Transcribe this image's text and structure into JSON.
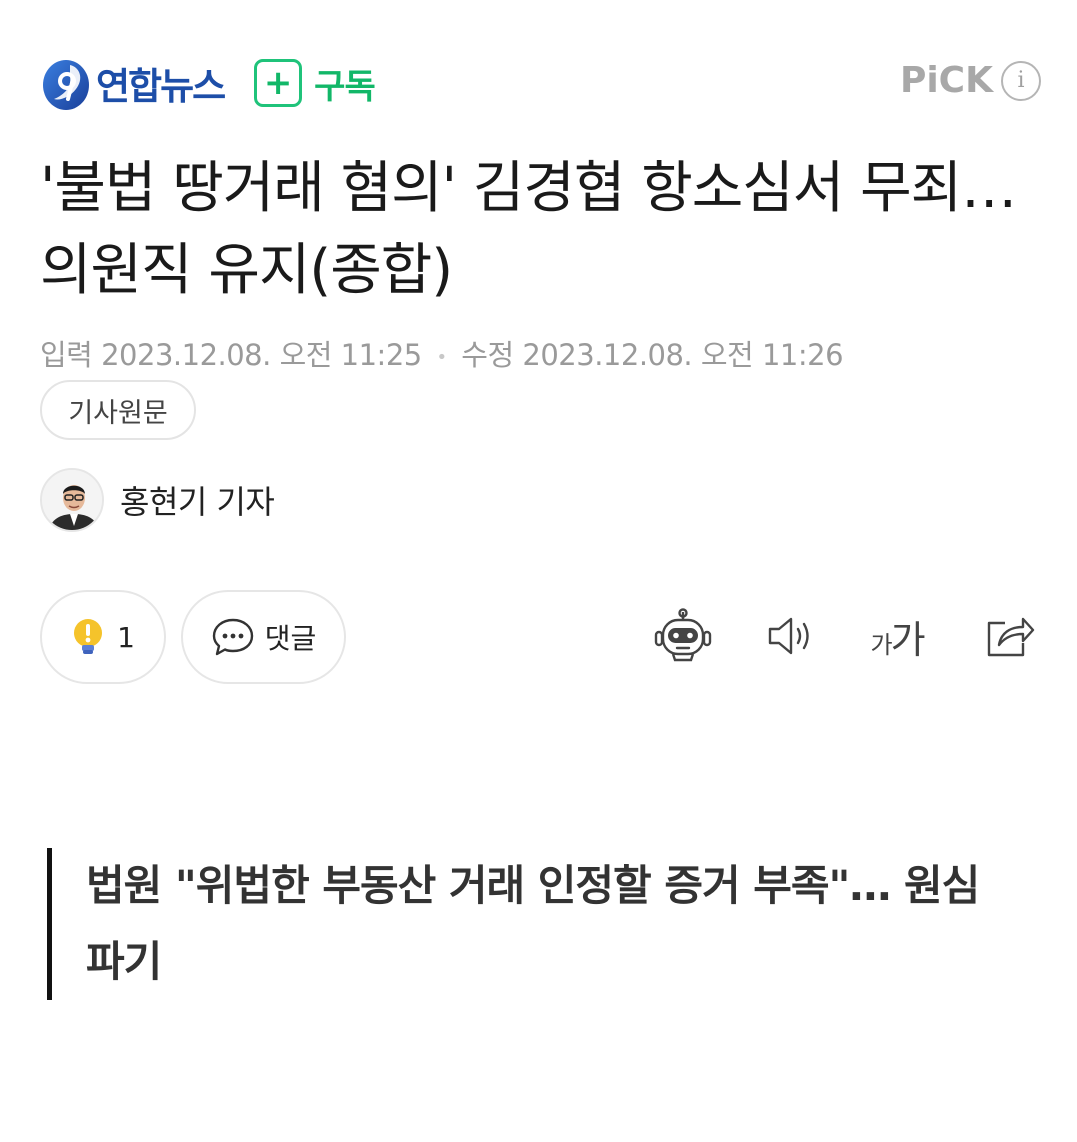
{
  "header": {
    "press_name": "연합뉴스",
    "subscribe_plus": "+",
    "subscribe_label": "구독",
    "pick_label": "PiCK",
    "info_label": "i"
  },
  "article": {
    "title": "'불법 땅거래 혐의' 김경협 항소심서 무죄…의원직 유지(종합)",
    "published_label": "입력",
    "published_at": "2023.12.08. 오전 11:25",
    "separator": "•",
    "modified_label": "수정",
    "modified_at": "2023.12.08. 오전 11:26",
    "original_link": "기사원문",
    "reporter": "홍현기 기자",
    "subheading": "법원 \"위법한 부동산 거래 인정할 증거 부족\"… 원심 파기"
  },
  "actions": {
    "reaction_count": "1",
    "comment_label": "댓글",
    "font_small": "가",
    "font_large": "가"
  },
  "colors": {
    "press_brand": "#1d4ea8",
    "subscribe_green": "#12b768",
    "pick_gray": "#a8a8a8",
    "reaction_bulb": "#f5c32b"
  },
  "icons": {
    "reaction": "lightbulb-icon",
    "comment": "speech-bubble-icon",
    "summary": "robot-icon",
    "tts": "speaker-icon",
    "font": "font-size-icon",
    "share": "share-icon"
  }
}
